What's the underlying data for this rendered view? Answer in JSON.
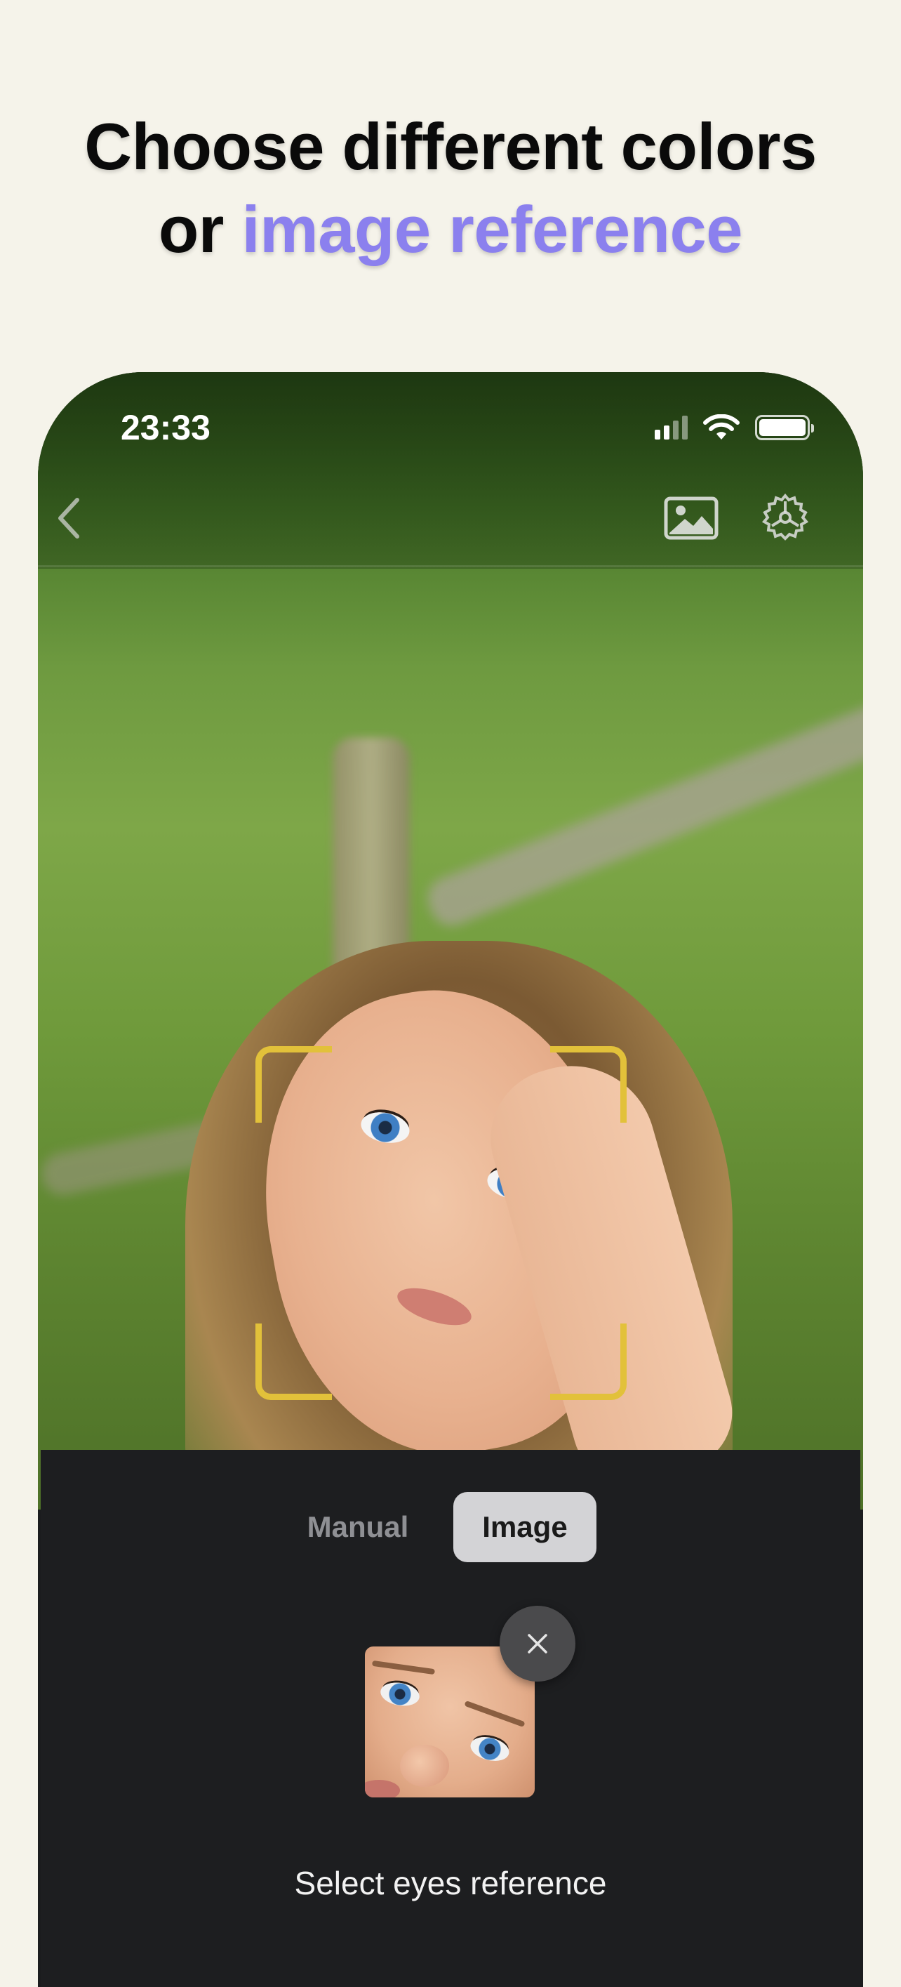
{
  "headline": {
    "line1": "Choose different colors",
    "line2_prefix": "or ",
    "line2_accent": "image reference"
  },
  "status_bar": {
    "time": "23:33",
    "icons": [
      "cellular-signal-icon",
      "wifi-icon",
      "battery-icon"
    ]
  },
  "nav": {
    "back_icon": "chevron-left-icon",
    "gallery_icon": "photo-gallery-icon",
    "settings_icon": "gear-icon"
  },
  "tabs": [
    {
      "label": "Manual",
      "selected": false
    },
    {
      "label": "Image",
      "selected": true
    }
  ],
  "reference": {
    "remove_icon": "close-icon",
    "caption": "Select eyes reference"
  },
  "colors": {
    "accent": "#8b80ee",
    "frame": "#e2c13a",
    "panel": "#1d1e20",
    "background": "#f5f3ea"
  }
}
